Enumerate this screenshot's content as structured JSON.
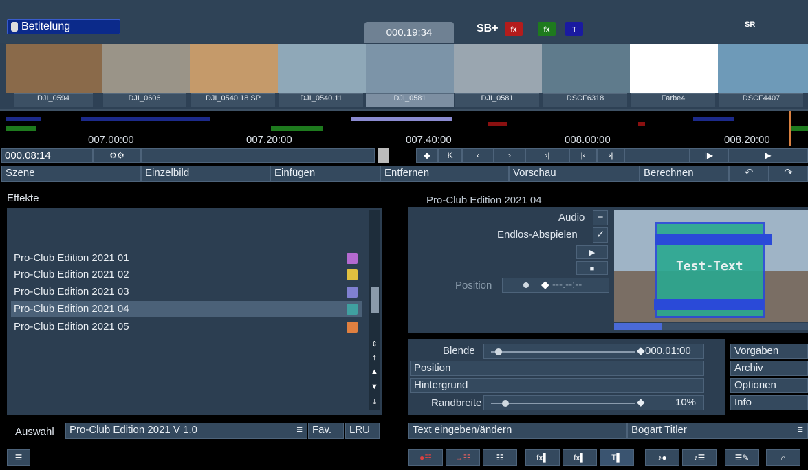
{
  "header": {
    "title": "Betitelung",
    "timecode": "000.19:34",
    "sb_label": "SB+",
    "fx_icons": [
      "fx",
      "fx",
      "T"
    ],
    "sr_label": "SR"
  },
  "filmstrip": {
    "clips": [
      {
        "label": "DJI_0594",
        "color": "#8a6a4a"
      },
      {
        "label": "DJI_0606",
        "color": "#9a9488"
      },
      {
        "label": "DJI_0540.18 SP",
        "color": "#c59a6a"
      },
      {
        "label": "DJI_0540.11",
        "color": "#8fa8b8"
      },
      {
        "label": "DJI_0581",
        "color": "#7c94a8"
      },
      {
        "label": "DJI_0581",
        "color": "#9aa6b0"
      },
      {
        "label": "DSCF6318",
        "color": "#5f7b8c"
      },
      {
        "label": "Farbe4",
        "color": "#ffffff"
      },
      {
        "label": "DSCF4407",
        "color": "#6e9ab8"
      }
    ],
    "selected_index": 4
  },
  "timeline": {
    "labels": [
      "007.00:00",
      "007.20:00",
      "007.40:00",
      "008.00:00",
      "008.20:00"
    ]
  },
  "transport": {
    "position": "000.08:14"
  },
  "menu": {
    "szene": "Szene",
    "einzelbild": "Einzelbild",
    "einfuegen": "Einfügen",
    "entfernen": "Entfernen",
    "vorschau": "Vorschau",
    "berechnen": "Berechnen"
  },
  "effects": {
    "header": "Effekte",
    "items": [
      {
        "label": "Pro-Club Edition 2021 01",
        "icon_color": "#b46ad0"
      },
      {
        "label": "Pro-Club Edition 2021 02",
        "icon_color": "#e0c040"
      },
      {
        "label": "Pro-Club Edition 2021 03",
        "icon_color": "#8080d0"
      },
      {
        "label": "Pro-Club Edition 2021 04",
        "icon_color": "#40a0a0"
      },
      {
        "label": "Pro-Club Edition 2021 05",
        "icon_color": "#e08040"
      }
    ],
    "selected_index": 3
  },
  "auswahl": {
    "label": "Auswahl",
    "value": "Pro-Club Edition 2021 V 1.0",
    "fav": "Fav.",
    "lru": "LRU"
  },
  "preview": {
    "title": "Pro-Club Edition 2021 04",
    "audio_label": "Audio",
    "loop_label": "Endlos-Abspielen",
    "position_label": "Position",
    "position_value": "---.--:--",
    "preview_text": "Test-Text"
  },
  "props": {
    "blende_label": "Blende",
    "blende_value": "000.01:00",
    "position": "Position",
    "hintergrund": "Hintergrund",
    "randbreite_label": "Randbreite",
    "randbreite_value": "10%",
    "blende_level": 0.05,
    "randbreite_level": 0.1
  },
  "side_buttons": [
    "Vorgaben",
    "Archiv",
    "Optionen",
    "Info"
  ],
  "text_row": {
    "edit": "Text eingeben/ändern",
    "titler": "Bogart Titler"
  },
  "colors": {
    "panel": "#2c3e51",
    "button": "#34495e",
    "selected": "#4b6178",
    "title_blue": "#0b2a8a"
  }
}
